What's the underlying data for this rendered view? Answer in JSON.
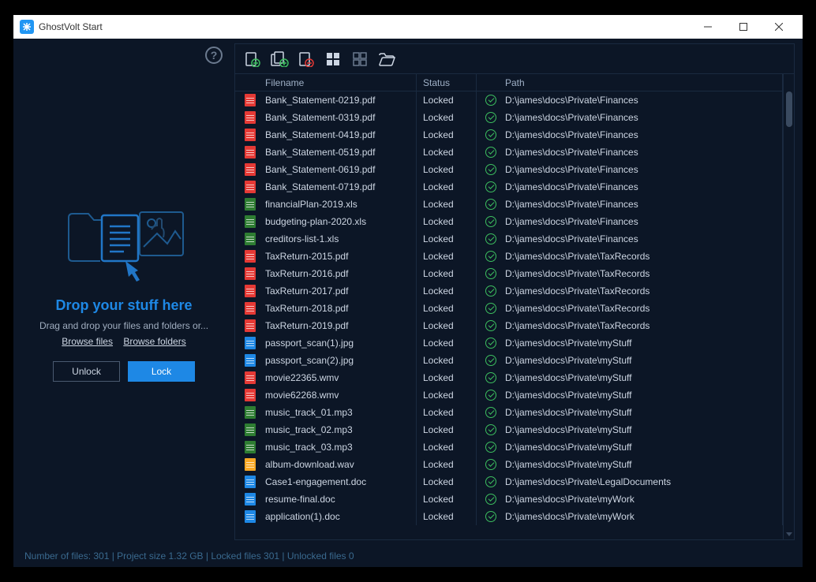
{
  "window": {
    "title": "GhostVolt Start"
  },
  "sidebar": {
    "drop_title": "Drop your stuff here",
    "drop_sub": "Drag and drop your files and folders or...",
    "browse_files": "Browse files",
    "browse_folders": "Browse folders",
    "unlock": "Unlock",
    "lock": "Lock"
  },
  "columns": {
    "filename": "Filename",
    "status": "Status",
    "path": "Path"
  },
  "colors": {
    "pdf": "#e53935",
    "xls": "#2e7d32",
    "doc": "#1e88e5",
    "wav": "#f9a825",
    "wmv": "#e53935",
    "mp3": "#2e7d32",
    "jpg": "#1e88e5"
  },
  "files": [
    {
      "name": "Bank_Statement-0219.pdf",
      "type": "pdf",
      "status": "Locked",
      "path": "D:\\james\\docs\\Private\\Finances"
    },
    {
      "name": "Bank_Statement-0319.pdf",
      "type": "pdf",
      "status": "Locked",
      "path": "D:\\james\\docs\\Private\\Finances"
    },
    {
      "name": "Bank_Statement-0419.pdf",
      "type": "pdf",
      "status": "Locked",
      "path": "D:\\james\\docs\\Private\\Finances"
    },
    {
      "name": "Bank_Statement-0519.pdf",
      "type": "pdf",
      "status": "Locked",
      "path": "D:\\james\\docs\\Private\\Finances"
    },
    {
      "name": "Bank_Statement-0619.pdf",
      "type": "pdf",
      "status": "Locked",
      "path": "D:\\james\\docs\\Private\\Finances"
    },
    {
      "name": "Bank_Statement-0719.pdf",
      "type": "pdf",
      "status": "Locked",
      "path": "D:\\james\\docs\\Private\\Finances"
    },
    {
      "name": "financialPlan-2019.xls",
      "type": "xls",
      "status": "Locked",
      "path": "D:\\james\\docs\\Private\\Finances"
    },
    {
      "name": "budgeting-plan-2020.xls",
      "type": "xls",
      "status": "Locked",
      "path": "D:\\james\\docs\\Private\\Finances"
    },
    {
      "name": "creditors-list-1.xls",
      "type": "xls",
      "status": "Locked",
      "path": "D:\\james\\docs\\Private\\Finances"
    },
    {
      "name": "TaxReturn-2015.pdf",
      "type": "pdf",
      "status": "Locked",
      "path": "D:\\james\\docs\\Private\\TaxRecords"
    },
    {
      "name": "TaxReturn-2016.pdf",
      "type": "pdf",
      "status": "Locked",
      "path": "D:\\james\\docs\\Private\\TaxRecords"
    },
    {
      "name": "TaxReturn-2017.pdf",
      "type": "pdf",
      "status": "Locked",
      "path": "D:\\james\\docs\\Private\\TaxRecords"
    },
    {
      "name": "TaxReturn-2018.pdf",
      "type": "pdf",
      "status": "Locked",
      "path": "D:\\james\\docs\\Private\\TaxRecords"
    },
    {
      "name": "TaxReturn-2019.pdf",
      "type": "pdf",
      "status": "Locked",
      "path": "D:\\james\\docs\\Private\\TaxRecords"
    },
    {
      "name": "passport_scan(1).jpg",
      "type": "jpg",
      "status": "Locked",
      "path": "D:\\james\\docs\\Private\\myStuff"
    },
    {
      "name": "passport_scan(2).jpg",
      "type": "jpg",
      "status": "Locked",
      "path": "D:\\james\\docs\\Private\\myStuff"
    },
    {
      "name": "movie22365.wmv",
      "type": "wmv",
      "status": "Locked",
      "path": "D:\\james\\docs\\Private\\myStuff"
    },
    {
      "name": "movie62268.wmv",
      "type": "wmv",
      "status": "Locked",
      "path": "D:\\james\\docs\\Private\\myStuff"
    },
    {
      "name": "music_track_01.mp3",
      "type": "mp3",
      "status": "Locked",
      "path": "D:\\james\\docs\\Private\\myStuff"
    },
    {
      "name": "music_track_02.mp3",
      "type": "mp3",
      "status": "Locked",
      "path": "D:\\james\\docs\\Private\\myStuff"
    },
    {
      "name": "music_track_03.mp3",
      "type": "mp3",
      "status": "Locked",
      "path": "D:\\james\\docs\\Private\\myStuff"
    },
    {
      "name": "album-download.wav",
      "type": "wav",
      "status": "Locked",
      "path": "D:\\james\\docs\\Private\\myStuff"
    },
    {
      "name": "Case1-engagement.doc",
      "type": "doc",
      "status": "Locked",
      "path": "D:\\james\\docs\\Private\\LegalDocuments"
    },
    {
      "name": "resume-final.doc",
      "type": "doc",
      "status": "Locked",
      "path": "D:\\james\\docs\\Private\\myWork"
    },
    {
      "name": "application(1).doc",
      "type": "doc",
      "status": "Locked",
      "path": "D:\\james\\docs\\Private\\myWork"
    }
  ],
  "statusbar": "Number of files: 301 | Project size 1.32 GB | Locked files 301 | Unlocked files 0"
}
